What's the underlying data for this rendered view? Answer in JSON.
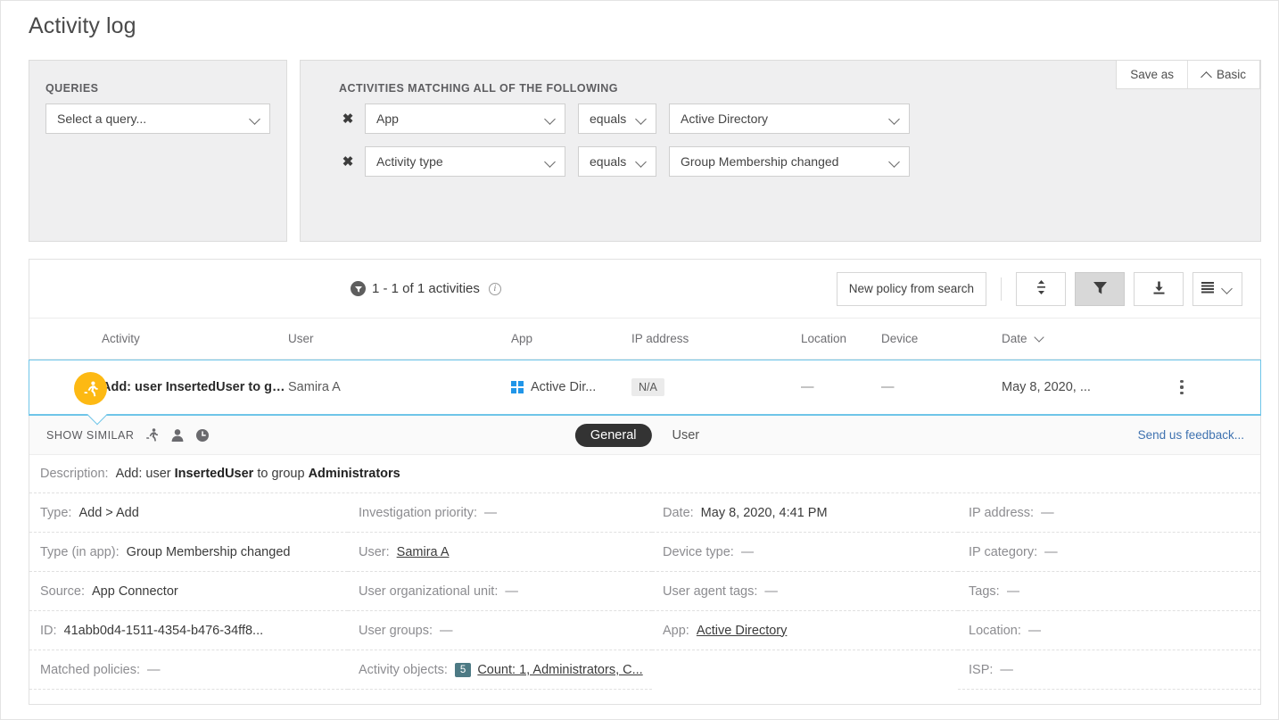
{
  "page": {
    "title": "Activity log"
  },
  "queries": {
    "label": "QUERIES",
    "select_value": "Select a query...",
    "placeholder": "Select a query..."
  },
  "conditions": {
    "label": "ACTIVITIES MATCHING ALL OF THE FOLLOWING",
    "rows": [
      {
        "field": "App",
        "operator": "equals",
        "value": "Active Directory",
        "remove": "✖"
      },
      {
        "field": "Activity type",
        "operator": "equals",
        "value": "Group Membership changed",
        "remove": "✖"
      }
    ],
    "add_label": "+"
  },
  "top_actions": {
    "save_as": "Save as",
    "basic": "Basic"
  },
  "toolbar": {
    "count_text": "1 - 1 of 1 activities",
    "new_policy": "New policy from search",
    "icons": {
      "sort": "sort-icon",
      "filter": "filter-icon",
      "export": "download-icon",
      "view": "list-view-icon"
    }
  },
  "table": {
    "headers": [
      "Activity",
      "User",
      "App",
      "IP address",
      "Location",
      "Device",
      "Date"
    ],
    "sort_column": "Date",
    "row": {
      "activity": "Add: user InsertedUser to group ...",
      "user": "Samira A",
      "app": "Active Dir...",
      "ip": "N/A",
      "location": "—",
      "device": "—",
      "date": "May 8, 2020, ..."
    }
  },
  "detail": {
    "show_similar": "SHOW SIMILAR",
    "tabs": [
      {
        "label": "General",
        "active": true
      },
      {
        "label": "User",
        "active": false
      }
    ],
    "feedback": "Send us feedback...",
    "description": {
      "label": "Description:",
      "prefix": "Add: user ",
      "bold1": "InsertedUser",
      "middle": " to group ",
      "bold2": "Administrators"
    },
    "columns": [
      [
        {
          "label": "Type:",
          "value": "Add > Add"
        },
        {
          "label": "Type (in app):",
          "value": "Group Membership changed"
        },
        {
          "label": "Source:",
          "value": "App Connector"
        },
        {
          "label": "ID:",
          "value": "41abb0d4-1511-4354-b476-34ff8..."
        },
        {
          "label": "Matched policies:",
          "value": "—"
        }
      ],
      [
        {
          "label": "Investigation priority:",
          "value": "—"
        },
        {
          "label": "User:",
          "value": "Samira A",
          "link": true
        },
        {
          "label": "User organizational unit:",
          "value": "—"
        },
        {
          "label": "User groups:",
          "value": "—"
        },
        {
          "label": "Activity objects:",
          "value": "Count: 1, Administrators, C...",
          "link": true,
          "badge": "5"
        }
      ],
      [
        {
          "label": "Date:",
          "value": "May 8, 2020, 4:41 PM"
        },
        {
          "label": "Device type:",
          "value": "—"
        },
        {
          "label": "User agent tags:",
          "value": "—"
        },
        {
          "label": "App:",
          "value": "Active Directory",
          "link": true
        },
        {
          "label": "",
          "value": ""
        }
      ],
      [
        {
          "label": "IP address:",
          "value": "—"
        },
        {
          "label": "IP category:",
          "value": "—"
        },
        {
          "label": "Tags:",
          "value": "—"
        },
        {
          "label": "Location:",
          "value": "—"
        },
        {
          "label": "ISP:",
          "value": "—"
        }
      ]
    ]
  },
  "colors": {
    "accent_blue": "#1b76bd",
    "avatar_orange": "#fdb913",
    "selected_border": "#6fc5e8",
    "badge_teal": "#4d7a84",
    "link_blue": "#3f72b0"
  }
}
